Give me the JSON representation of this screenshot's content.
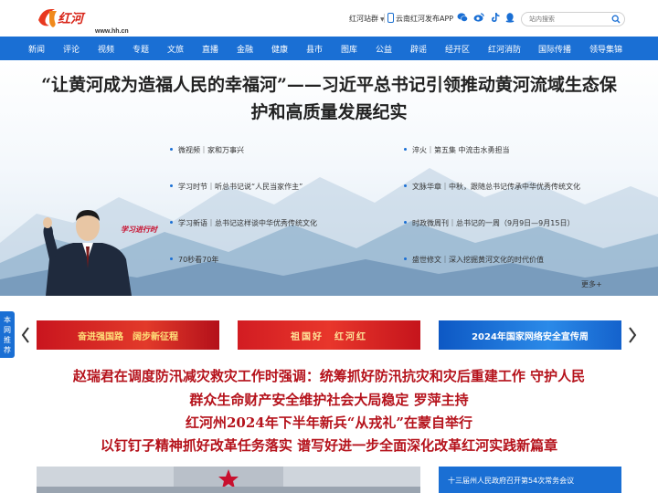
{
  "header": {
    "logo_text": "红河网",
    "logo_url": "www.hh.cn",
    "site_group": "红河站群",
    "app_label": "云南红河发布APP",
    "search_placeholder": "站内搜索",
    "social_icons": [
      "wechat-icon",
      "weibo-icon",
      "douyin-icon",
      "qq-icon"
    ]
  },
  "nav": {
    "items": [
      "新闻",
      "评论",
      "视频",
      "专题",
      "文旅",
      "直播",
      "金融",
      "健康",
      "县市",
      "图库",
      "公益",
      "辟谣",
      "经开区",
      "红河消防",
      "国际传播",
      "领导集锦"
    ]
  },
  "hero": {
    "title_line1": "“让黄河成为造福人民的幸福河”——习近平总书记引领推动黄河流域生态保",
    "title_line2": "护和高质量发展纪实",
    "links_left": [
      "微视频｜家和万事兴",
      "学习时节｜听总书记说“人民当家作主”",
      "学习新语｜总书记这样谈中华优秀传统文化",
      "70秒看70年"
    ],
    "links_right": [
      "淬火｜第五集 中流击水勇担当",
      "文脉华章｜中秋，跟随总书记传承中华优秀传统文化",
      "时政微周刊｜总书记的一周（9月9日—9月15日）",
      "盛世修文｜深入挖掘黄河文化的时代价值"
    ],
    "more": "更多+",
    "badge": "学习进行时"
  },
  "side_tab": {
    "label": "本网推荐"
  },
  "banners": [
    "奋进强国路　阔步新征程",
    "祖国好　红河红",
    "2024年国家网络安全宣传周"
  ],
  "headlines": [
    "赵瑞君在调度防汛减灾救灾工作时强调：统筹抓好防汛抗灾和灾后重建工作 守护人民",
    "群众生命财产安全维护社会大局稳定 罗萍主持",
    "红河州2024年下半年新兵“从戎礼”在蒙自举行",
    "以钉钉子精神抓好改革任务落实 谱写好进一步全面深化改革红河实践新篇章"
  ],
  "bottom": {
    "news_item": "十三届州人民政府召开第54次常务会议"
  },
  "colors": {
    "nav_blue": "#1a6fd4",
    "headline_red": "#b5121b",
    "logo_red": "#e8381e"
  }
}
